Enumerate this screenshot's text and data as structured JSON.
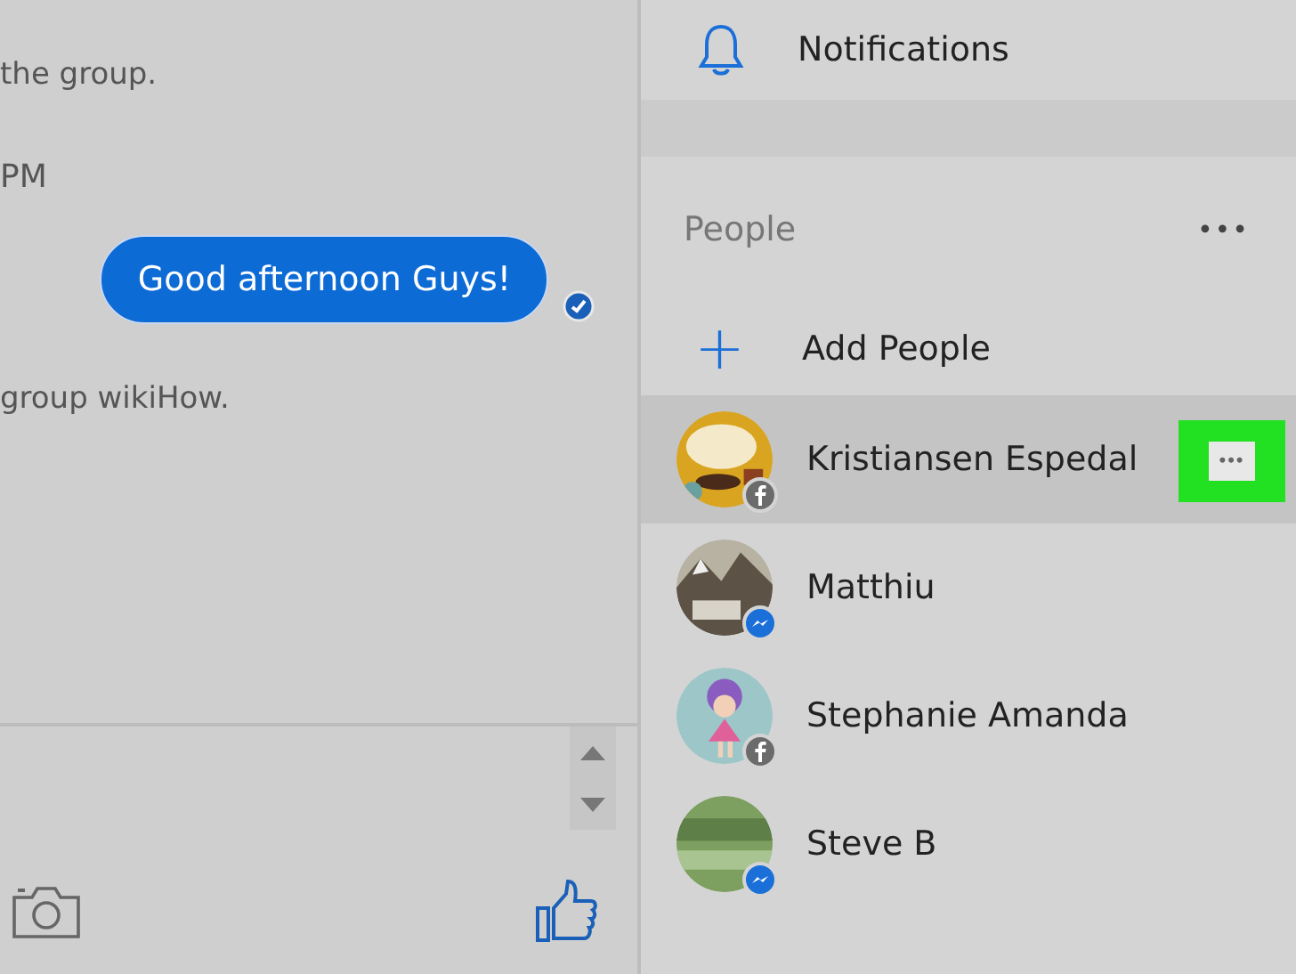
{
  "chat": {
    "messages": [
      {
        "kind": "notice",
        "text": "the group."
      },
      {
        "kind": "time",
        "text": "PM"
      },
      {
        "kind": "outgoing",
        "text": "Good afternoon Guys!",
        "seen": true
      },
      {
        "kind": "notice",
        "text": "group wikiHow."
      }
    ]
  },
  "sidebar": {
    "notifications": {
      "label": "Notifications"
    },
    "people": {
      "title": "People",
      "more": "•••",
      "add_label": "Add People",
      "add_icon": "+",
      "items": [
        {
          "name": "Kristiansen Espedal",
          "selected": true,
          "badge": {
            "kind": "facebook"
          }
        },
        {
          "name": "Matthiu",
          "selected": false,
          "badge": {
            "kind": "messenger"
          }
        },
        {
          "name": "Stephanie Amanda",
          "selected": false,
          "badge": {
            "kind": "facebook"
          }
        },
        {
          "name": "Steve B",
          "selected": false,
          "badge": {
            "kind": "messenger"
          }
        }
      ]
    },
    "row_menu": "•••"
  }
}
